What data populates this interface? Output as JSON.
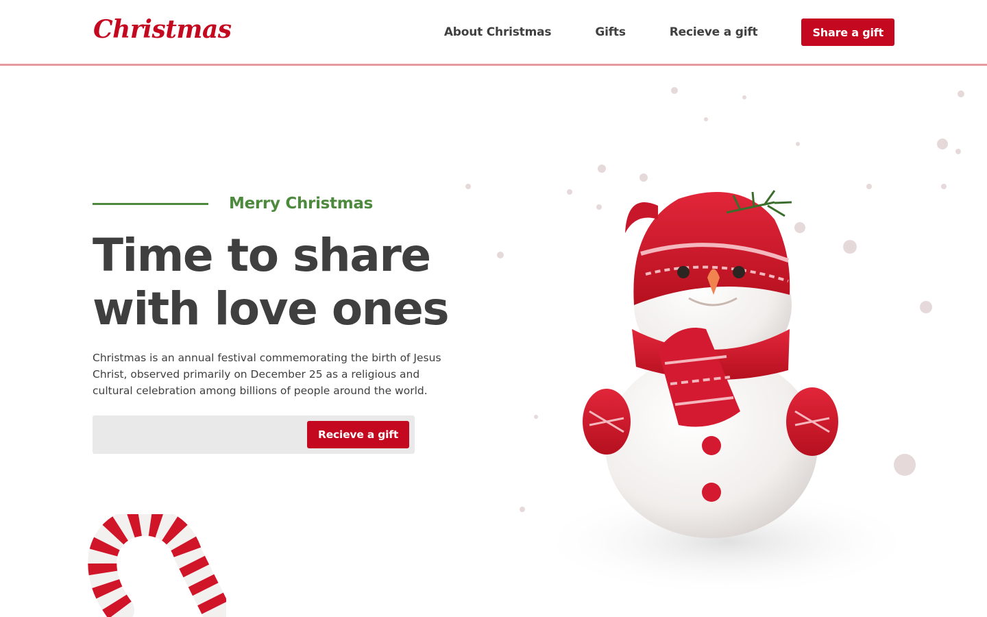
{
  "brand": {
    "logo_text": "Christmas",
    "accent_color": "#c4081f",
    "green_color": "#4d8a3d"
  },
  "nav": {
    "links": [
      {
        "label": "About Christmas"
      },
      {
        "label": "Gifts"
      },
      {
        "label": "Recieve a gift"
      }
    ],
    "cta_label": "Share a gift"
  },
  "hero": {
    "eyebrow": "Merry Christmas",
    "headline_line1": "Time to share",
    "headline_line2": "with love ones",
    "description_line1": "Christmas is an annual festival commemorating the birth of Jesus",
    "description_line2": "Christ, observed primarily on December 25 as a religious and",
    "description_line3": "cultural celebration among billions of people around the world.",
    "form": {
      "input_value": "",
      "button_label": "Recieve a gift"
    }
  },
  "illustrations": {
    "main": "snowman-illustration",
    "corner": "candy-cane-illustration"
  }
}
